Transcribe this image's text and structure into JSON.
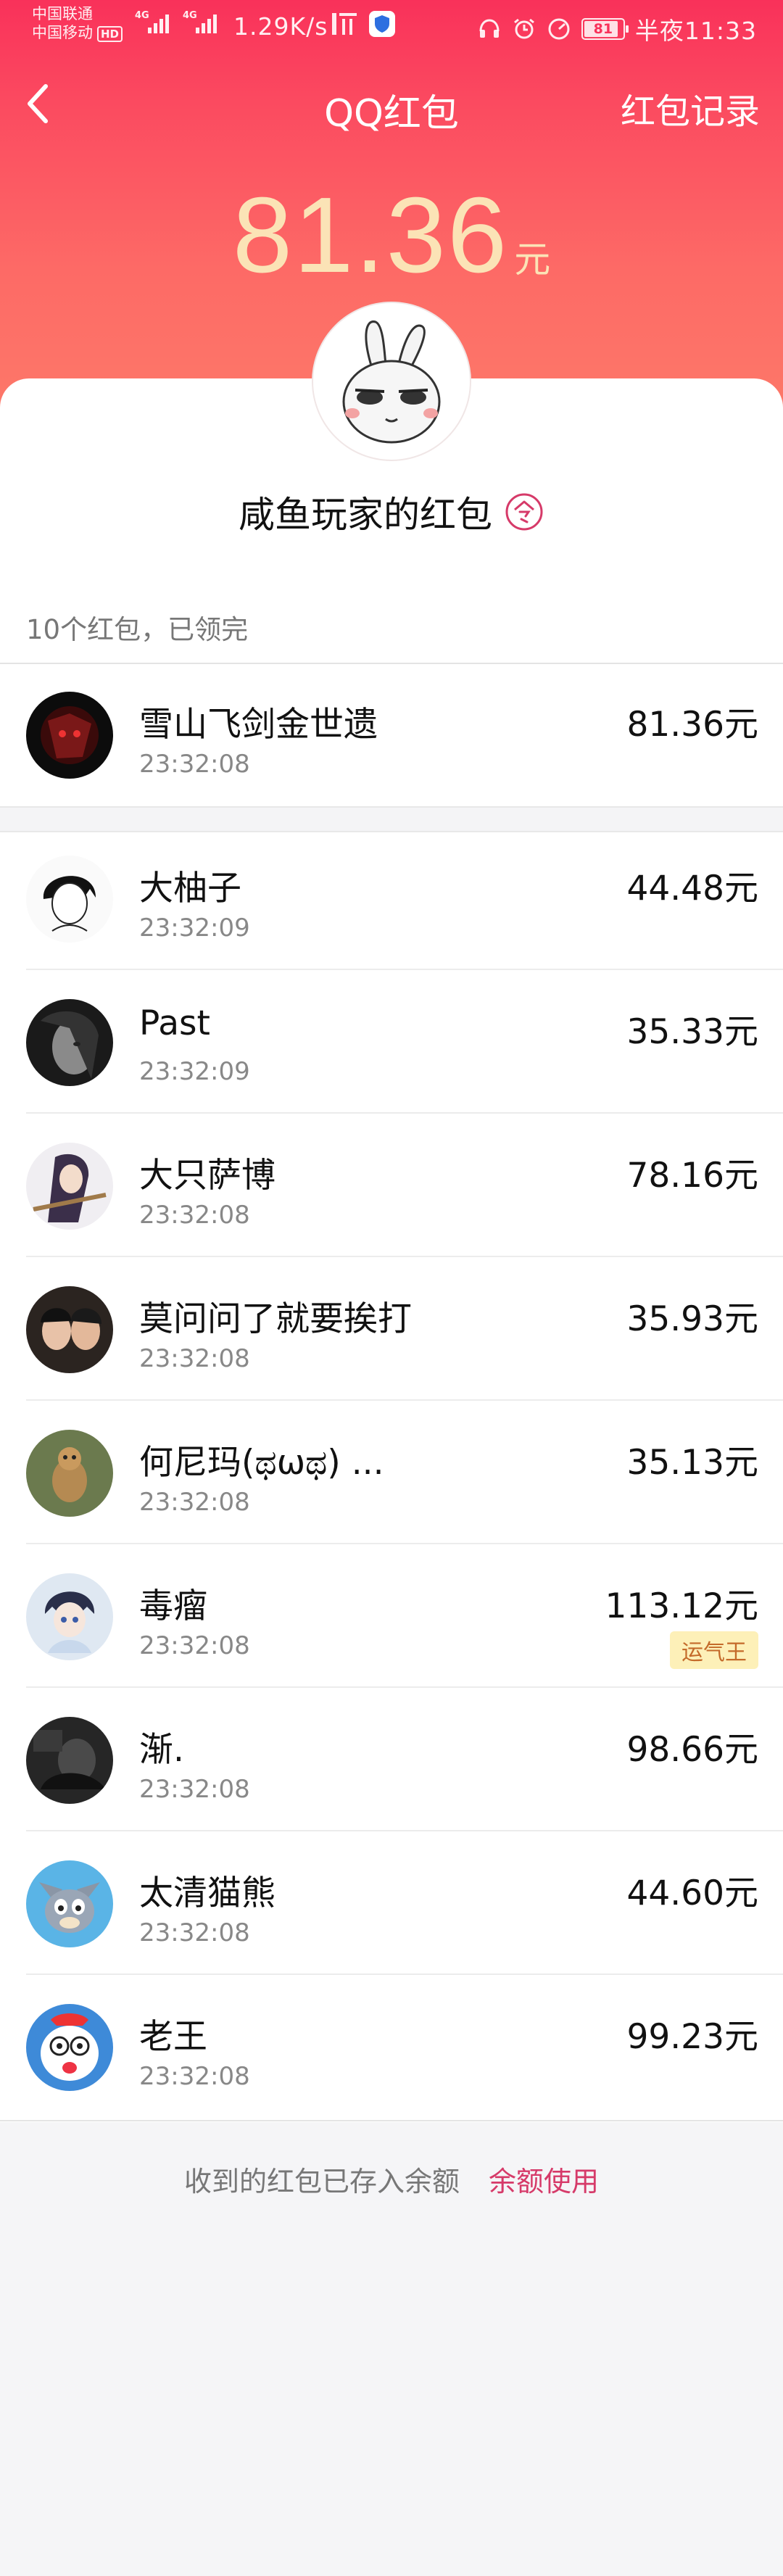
{
  "status_bar": {
    "carrier_1": "中国联通",
    "carrier_2": "中国移动",
    "hd": "HD",
    "net_1": "4G",
    "net_2": "4G",
    "speed": "1.29K/s",
    "battery": "81",
    "time": "半夜11:33"
  },
  "header": {
    "title": "QQ红包",
    "records_link": "红包记录"
  },
  "amount": {
    "value": "81.36",
    "unit": "元"
  },
  "sender": {
    "name": "咸鱼玩家的红包"
  },
  "summary": "10个红包，已领完",
  "self_record": {
    "name": "雪山飞剑金世遗",
    "time": "23:32:08",
    "amount": "81.36元"
  },
  "records": [
    {
      "name": "大柚子",
      "time": "23:32:09",
      "amount": "44.48元"
    },
    {
      "name": "Past",
      "time": "23:32:09",
      "amount": "35.33元"
    },
    {
      "name": "大只萨博",
      "time": "23:32:08",
      "amount": "78.16元"
    },
    {
      "name": "莫问问了就要挨打",
      "time": "23:32:08",
      "amount": "35.93元"
    },
    {
      "name": "何尼玛(ಥωಥ)  ...",
      "time": "23:32:08",
      "amount": "35.13元"
    },
    {
      "name": "毒瘤",
      "time": "23:32:08",
      "amount": "113.12元",
      "badge": "运气王"
    },
    {
      "name": "渐.",
      "time": "23:32:08",
      "amount": "98.66元"
    },
    {
      "name": "太清猫熊",
      "time": "23:32:08",
      "amount": "44.60元"
    },
    {
      "name": "老王",
      "time": "23:32:08",
      "amount": "99.23元"
    }
  ],
  "footer": {
    "note": "收到的红包已存入余额",
    "link": "余额使用"
  },
  "colors": {
    "header_top": "#f9315a",
    "header_bottom": "#fd7d6a",
    "amount": "#fbe3b6",
    "accent_link": "#d63a69",
    "badge_bg": "#fdf0b8"
  },
  "icons": {
    "back": "chevron-left-icon",
    "token": "ling-token-icon",
    "status": [
      "headphone-icon",
      "alarm-icon",
      "speedometer-icon",
      "battery-icon"
    ]
  }
}
